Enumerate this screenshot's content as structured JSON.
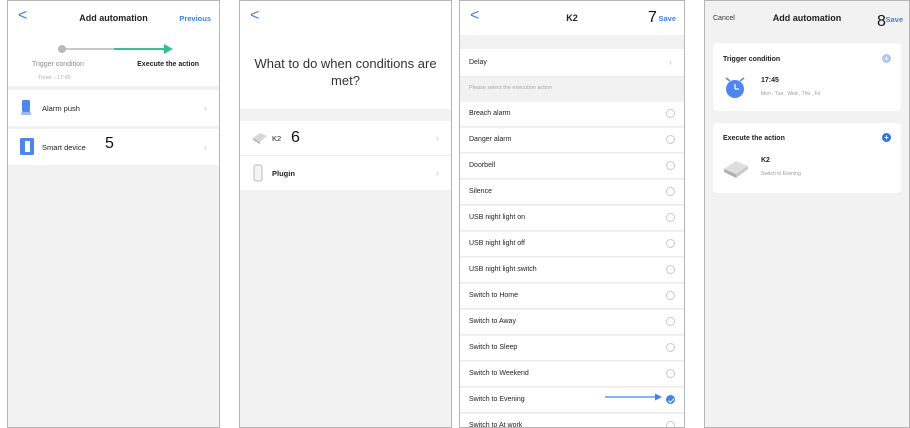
{
  "panel1": {
    "back_glyph": "<",
    "title": "Add automation",
    "action": "Previous",
    "step_left": "Trigger condition",
    "step_right": "Execute the action",
    "step_sub": "Timer - 17:45",
    "items": [
      {
        "label": "Alarm push",
        "icon": "alarm-push-icon"
      },
      {
        "label": "Smart device",
        "icon": "smart-device-icon"
      }
    ],
    "step_number": "5"
  },
  "panel2": {
    "back_glyph": "<",
    "question": "What to do when conditions are met?",
    "items": [
      {
        "label": "K2",
        "icon": "k2-device-icon"
      },
      {
        "label": "Plugin",
        "icon": "plugin-icon"
      }
    ],
    "step_number": "6"
  },
  "panel3": {
    "back_glyph": "<",
    "title": "K2",
    "action": "Save",
    "step_number": "7",
    "delay": "Delay",
    "hint": "Please select the execution action",
    "actions": [
      {
        "label": "Breach alarm",
        "selected": false
      },
      {
        "label": "Danger alarm",
        "selected": false
      },
      {
        "label": "Doorbell",
        "selected": false
      },
      {
        "label": "Silence",
        "selected": false
      },
      {
        "label": "USB night light on",
        "selected": false
      },
      {
        "label": "USB night light off",
        "selected": false
      },
      {
        "label": "USB night light switch",
        "selected": false
      },
      {
        "label": "Switch to Home",
        "selected": false
      },
      {
        "label": "Switch to Away",
        "selected": false
      },
      {
        "label": "Switch to Sleep",
        "selected": false
      },
      {
        "label": "Switch to Weekend",
        "selected": false
      },
      {
        "label": "Switch to Evening",
        "selected": true
      },
      {
        "label": "Switch to At work",
        "selected": false
      }
    ]
  },
  "panel4": {
    "cancel": "Cancel",
    "title": "Add automation",
    "step_number": "8",
    "action": "Save",
    "trigger_header": "Trigger condition",
    "trigger_time": "17:45",
    "trigger_days": "Mon , Tue , Wed , Thu , Fri",
    "execute_header": "Execute the action",
    "execute_device": "K2",
    "execute_action": "Switch to Evening"
  },
  "colors": {
    "accent": "#3b82f6",
    "progress_green": "#34c08f",
    "trigger_plus": "#a9c4f5",
    "execute_plus": "#2f6ff0"
  }
}
